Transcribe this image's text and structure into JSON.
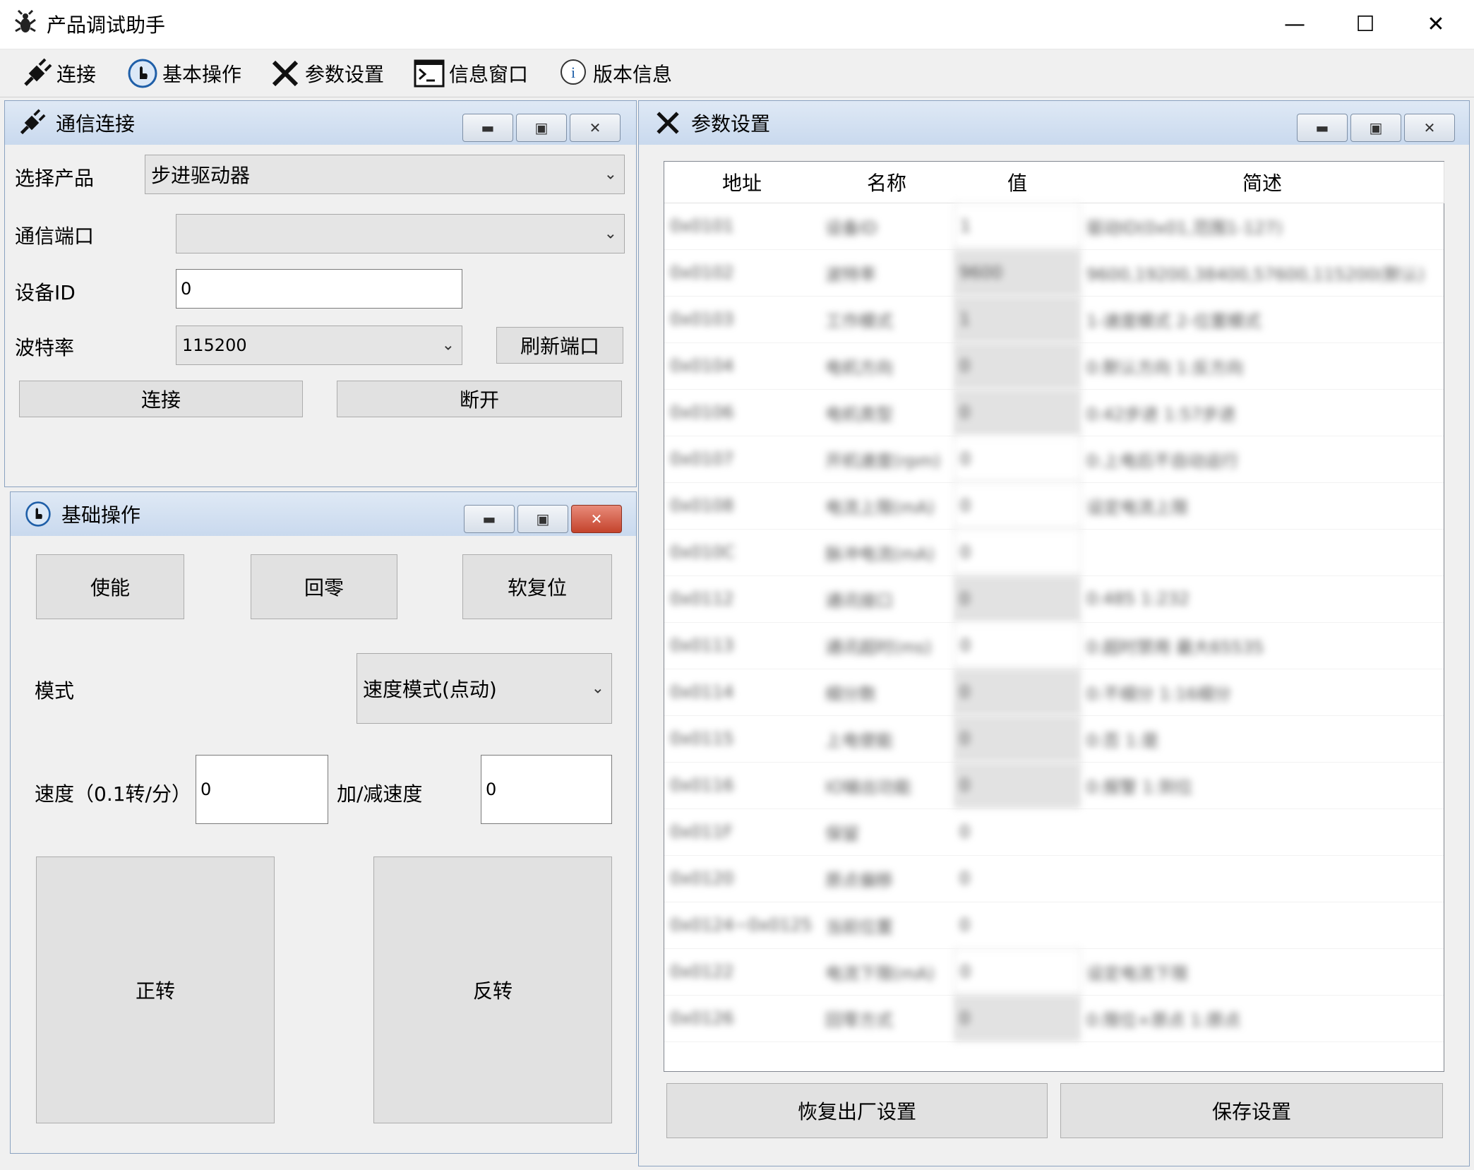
{
  "window": {
    "title": "产品调试助手",
    "minimize": "—",
    "maximize": "☐",
    "close": "✕"
  },
  "toolbar": [
    {
      "label": "连接",
      "icon": "plug-icon"
    },
    {
      "label": "基本操作",
      "icon": "hand-icon"
    },
    {
      "label": "参数设置",
      "icon": "tools-icon"
    },
    {
      "label": "信息窗口",
      "icon": "terminal-icon"
    },
    {
      "label": "版本信息",
      "icon": "info-icon"
    }
  ],
  "comm": {
    "title": "通信连接",
    "product_label": "选择产品",
    "product_value": "步进驱动器",
    "port_label": "通信端口",
    "port_value": "",
    "device_id_label": "设备ID",
    "device_id_value": "0",
    "baud_label": "波特率",
    "baud_value": "115200",
    "refresh_button": "刷新端口",
    "connect_button": "连接",
    "disconnect_button": "断开"
  },
  "basic": {
    "title": "基础操作",
    "enable_button": "使能",
    "home_button": "回零",
    "reset_button": "软复位",
    "mode_label": "模式",
    "mode_value": "速度模式(点动)",
    "speed_label": "速度（0.1转/分）",
    "speed_value": "0",
    "accel_label": "加/减速度",
    "accel_value": "0",
    "forward_button": "正转",
    "reverse_button": "反转"
  },
  "params": {
    "title": "参数设置",
    "columns": [
      "地址",
      "名称",
      "值",
      "简述"
    ],
    "rows": [
      {
        "addr": "0x0101",
        "name": "设备ID",
        "value": "1",
        "kind": "input",
        "desc": "驱动ID(0x01,范围1-127)"
      },
      {
        "addr": "0x0102",
        "name": "波特率",
        "value": "9600",
        "kind": "combo",
        "desc": "9600,19200,38400,57600,115200(默认)"
      },
      {
        "addr": "0x0103",
        "name": "工作模式",
        "value": "1",
        "kind": "combo",
        "desc": "1-速度模式 2-位置模式"
      },
      {
        "addr": "0x0104",
        "name": "电机方向",
        "value": "0",
        "kind": "combo",
        "desc": "0:默认方向 1:反方向"
      },
      {
        "addr": "0x0106",
        "name": "电机类型",
        "value": "0",
        "kind": "combo",
        "desc": "0:42步进 1:57步进"
      },
      {
        "addr": "0x0107",
        "name": "开机速度(rpm)",
        "value": "0",
        "kind": "input",
        "desc": "0:上电后不自动运行"
      },
      {
        "addr": "0x0108",
        "name": "电流上限(mA)",
        "value": "0",
        "kind": "input",
        "desc": "设定电流上限"
      },
      {
        "addr": "0x010C",
        "name": "脉冲电流(mA)",
        "value": "0",
        "kind": "input",
        "desc": ""
      },
      {
        "addr": "0x0112",
        "name": "通讯接口",
        "value": "0",
        "kind": "combo",
        "desc": "0:485 1:232"
      },
      {
        "addr": "0x0113",
        "name": "通讯超时(ms)",
        "value": "0",
        "kind": "input",
        "desc": "0:超时禁用 最大65535"
      },
      {
        "addr": "0x0114",
        "name": "细分数",
        "value": "0",
        "kind": "combo",
        "desc": "0:不细分 1:16细分"
      },
      {
        "addr": "0x0115",
        "name": "上电使能",
        "value": "0",
        "kind": "combo",
        "desc": "0:否 1:是"
      },
      {
        "addr": "0x0116",
        "name": "IO输出功能",
        "value": "0",
        "kind": "combo",
        "desc": "0:报警 1:到位"
      },
      {
        "addr": "0x011F",
        "name": "保留",
        "value": "0",
        "kind": "plain",
        "desc": ""
      },
      {
        "addr": "0x0120",
        "name": "原点偏移",
        "value": "0",
        "kind": "plain",
        "desc": ""
      },
      {
        "addr": "0x0124~0x0125",
        "name": "当前位置",
        "value": "0",
        "kind": "plain",
        "desc": ""
      },
      {
        "addr": "0x0122",
        "name": "电流下限(mA)",
        "value": "0",
        "kind": "input",
        "desc": "设定电流下限"
      },
      {
        "addr": "0x0126",
        "name": "回零方式",
        "value": "0",
        "kind": "combo",
        "desc": "0:限位+原点 1:原点"
      }
    ],
    "restore_button": "恢复出厂设置",
    "save_button": "保存设置"
  }
}
